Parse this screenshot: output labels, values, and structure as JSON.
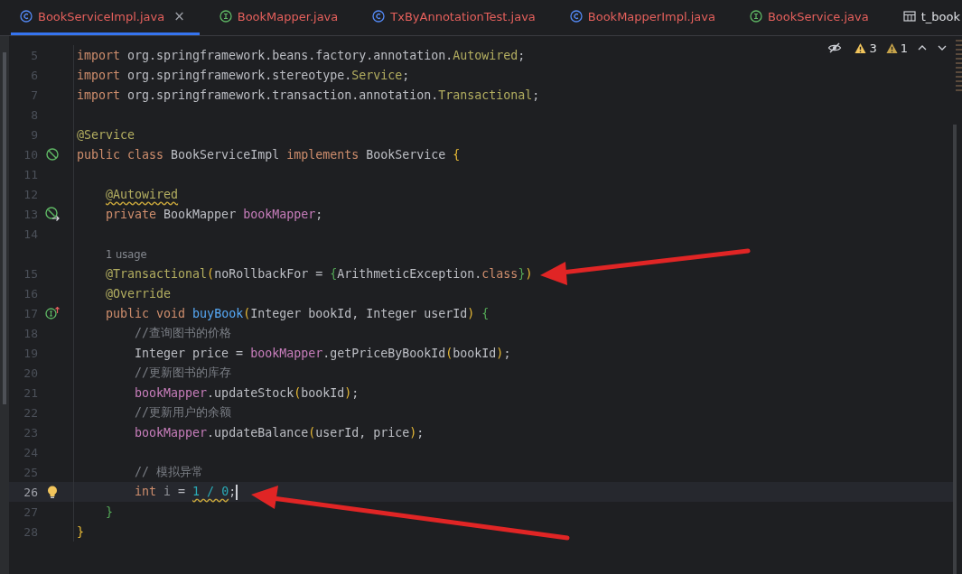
{
  "tabs": [
    {
      "label": "BookServiceImpl.java",
      "kind": "class",
      "has_errors": true,
      "selected": true,
      "close": "×"
    },
    {
      "label": "BookMapper.java",
      "kind": "interface",
      "has_errors": true,
      "selected": false
    },
    {
      "label": "TxByAnnotationTest.java",
      "kind": "class",
      "has_errors": true,
      "selected": false
    },
    {
      "label": "BookMapperImpl.java",
      "kind": "class",
      "has_errors": true,
      "selected": false
    },
    {
      "label": "BookService.java",
      "kind": "interface",
      "has_errors": true,
      "selected": false
    },
    {
      "label": "t_book",
      "kind": "table",
      "has_errors": false,
      "selected": false
    }
  ],
  "inspections": {
    "warnings": "3",
    "weak_warnings": "1"
  },
  "lines": [
    {
      "number": "5",
      "current": false,
      "tokens": [
        {
          "t": "import ",
          "kind": "kw"
        },
        {
          "t": "org.springframework.beans.factory.annotation.",
          "kind": "plain"
        },
        {
          "t": "Autowired",
          "kind": "ann"
        },
        {
          "t": ";",
          "kind": "plain"
        }
      ]
    },
    {
      "number": "6",
      "current": false,
      "tokens": [
        {
          "t": "import ",
          "kind": "kw"
        },
        {
          "t": "org.springframework.stereotype.",
          "kind": "plain"
        },
        {
          "t": "Service",
          "kind": "ann"
        },
        {
          "t": ";",
          "kind": "plain"
        }
      ]
    },
    {
      "number": "7",
      "current": false,
      "tokens": [
        {
          "t": "import ",
          "kind": "kw"
        },
        {
          "t": "org.springframework.transaction.annotation.",
          "kind": "plain"
        },
        {
          "t": "Transactional",
          "kind": "ann"
        },
        {
          "t": ";",
          "kind": "plain"
        }
      ]
    },
    {
      "number": "8",
      "current": false
    },
    {
      "number": "9",
      "current": false,
      "tokens": [
        {
          "t": "@Service",
          "kind": "ann"
        }
      ]
    },
    {
      "number": "10",
      "current": false,
      "gutter": {
        "kind": "bean"
      },
      "tokens": [
        {
          "t": "public class ",
          "kind": "kw"
        },
        {
          "t": "BookServiceImpl ",
          "kind": "plain"
        },
        {
          "t": "implements ",
          "kind": "kw"
        },
        {
          "t": "BookService ",
          "kind": "plain"
        },
        {
          "t": "{",
          "kind": "b1"
        }
      ]
    },
    {
      "number": "11",
      "current": false
    },
    {
      "number": "12",
      "current": false,
      "tokens": [
        {
          "t": "    @Autowired",
          "kind": "ann",
          "warn": true
        }
      ]
    },
    {
      "number": "13",
      "current": false,
      "gutter": {
        "kind": "bean-link"
      },
      "tokens": [
        {
          "t": "    private ",
          "kind": "kw"
        },
        {
          "t": "BookMapper ",
          "kind": "plain"
        },
        {
          "t": "bookMapper",
          "kind": "field"
        },
        {
          "t": ";",
          "kind": "plain"
        }
      ]
    },
    {
      "number": "14",
      "current": false
    },
    {
      "hint": "1 usage",
      "number": "15",
      "current": false,
      "tokens": [
        {
          "t": "    @Transactional",
          "kind": "ann"
        },
        {
          "t": "(",
          "kind": "b1"
        },
        {
          "t": "noRollbackFor = ",
          "kind": "plain"
        },
        {
          "t": "{",
          "kind": "b2"
        },
        {
          "t": "ArithmeticException.",
          "kind": "plain"
        },
        {
          "t": "class",
          "kind": "kw"
        },
        {
          "t": "}",
          "kind": "b2"
        },
        {
          "t": ")",
          "kind": "b1"
        }
      ]
    },
    {
      "number": "16",
      "current": false,
      "tokens": [
        {
          "t": "    @Override",
          "kind": "ann"
        }
      ]
    },
    {
      "number": "17",
      "current": false,
      "gutter": {
        "kind": "implements"
      },
      "tokens": [
        {
          "t": "    public void ",
          "kind": "kw"
        },
        {
          "t": "buyBook",
          "kind": "method"
        },
        {
          "t": "(",
          "kind": "b1"
        },
        {
          "t": "Integer bookId, Integer userId",
          "kind": "plain"
        },
        {
          "t": ") ",
          "kind": "b1"
        },
        {
          "t": "{",
          "kind": "b2"
        }
      ]
    },
    {
      "number": "18",
      "current": false,
      "tokens": [
        {
          "t": "        //查询图书的价格",
          "kind": "comment"
        }
      ]
    },
    {
      "number": "19",
      "current": false,
      "tokens": [
        {
          "t": "        Integer price = ",
          "kind": "plain"
        },
        {
          "t": "bookMapper",
          "kind": "field"
        },
        {
          "t": ".getPriceByBookId",
          "kind": "plain"
        },
        {
          "t": "(",
          "kind": "b1"
        },
        {
          "t": "bookId",
          "kind": "plain"
        },
        {
          "t": ")",
          "kind": "b1"
        },
        {
          "t": ";",
          "kind": "plain"
        }
      ]
    },
    {
      "number": "20",
      "current": false,
      "tokens": [
        {
          "t": "        //更新图书的库存",
          "kind": "comment"
        }
      ]
    },
    {
      "number": "21",
      "current": false,
      "tokens": [
        {
          "t": "        bookMapper",
          "kind": "field"
        },
        {
          "t": ".updateStock",
          "kind": "plain"
        },
        {
          "t": "(",
          "kind": "b1"
        },
        {
          "t": "bookId",
          "kind": "plain"
        },
        {
          "t": ")",
          "kind": "b1"
        },
        {
          "t": ";",
          "kind": "plain"
        }
      ]
    },
    {
      "number": "22",
      "current": false,
      "tokens": [
        {
          "t": "        //更新用户的余额",
          "kind": "comment"
        }
      ]
    },
    {
      "number": "23",
      "current": false,
      "tokens": [
        {
          "t": "        bookMapper",
          "kind": "field"
        },
        {
          "t": ".updateBalance",
          "kind": "plain"
        },
        {
          "t": "(",
          "kind": "b1"
        },
        {
          "t": "userId, price",
          "kind": "plain"
        },
        {
          "t": ")",
          "kind": "b1"
        },
        {
          "t": ";",
          "kind": "plain"
        }
      ]
    },
    {
      "number": "24",
      "current": false
    },
    {
      "number": "25",
      "current": false,
      "tokens": [
        {
          "t": "        // 模拟异常",
          "kind": "comment"
        }
      ]
    },
    {
      "number": "26",
      "current": true,
      "gutter": {
        "kind": "bulb"
      },
      "tokens": [
        {
          "t": "        int ",
          "kind": "kw"
        },
        {
          "t": "i ",
          "kind": "local"
        },
        {
          "t": "= ",
          "kind": "plain"
        },
        {
          "t": "1 / 0",
          "kind": "num",
          "warn": true
        },
        {
          "t": ";",
          "kind": "plain"
        }
      ]
    },
    {
      "number": "27",
      "current": false,
      "tokens": [
        {
          "t": "    }",
          "kind": "b2"
        }
      ]
    },
    {
      "number": "28",
      "current": false,
      "tokens": [
        {
          "t": "}",
          "kind": "b1"
        }
      ]
    }
  ]
}
